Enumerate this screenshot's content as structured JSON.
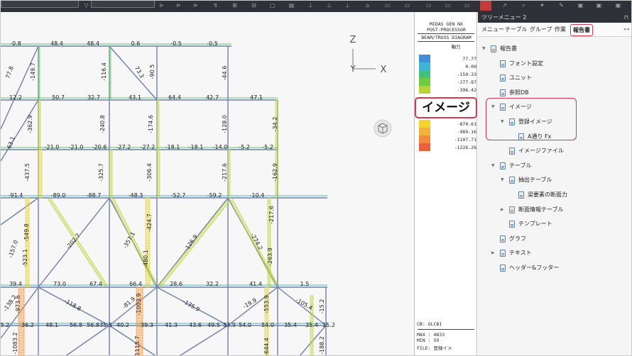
{
  "viewport": {
    "frame_values": {
      "top_beams": [
        "-0.8",
        "48.4",
        "48.4",
        "0.6",
        "-0.5",
        "-0.5"
      ],
      "row1": [
        "12.2",
        "50.7",
        "32.7",
        "43.1",
        "64.4",
        "42.7",
        "47.1"
      ],
      "row2": [
        "-21.0",
        "-21.0",
        "-20.6",
        "-27.2",
        "-27.2",
        "-18.1",
        "-18.1",
        "-14.0",
        "-5.2",
        "-5.2"
      ],
      "row3": [
        "-91.4",
        "-89.0",
        "-88.7",
        "-48.3",
        "-52.7",
        "-59.2",
        "-10.4"
      ],
      "row4": [
        "39.4",
        "73.0",
        "67.4",
        "66.4",
        "28.6",
        "32.2",
        "41.4",
        "1.5"
      ],
      "row5": [
        "5.2",
        "36.2",
        "48.1",
        "56.8",
        "56.8",
        "35.5",
        "40.2",
        "39.3",
        "41.3",
        "43.6",
        "49.5",
        "53.9",
        "54.0",
        "54.0",
        "35.4",
        "35.4",
        "15.2"
      ],
      "columns_top": [
        "77.8",
        "-149.7",
        "-116.4",
        "73.3",
        "-90.5",
        "-44.6"
      ],
      "columns_mid": [
        "-362.9",
        "-240.8",
        "-174.6",
        "-128.0",
        "-34.2",
        "63.1"
      ],
      "columns_low": [
        "-437.5",
        "-325.7",
        "-306.4",
        "-217.6",
        "-162.9"
      ],
      "columns_lower": [
        "-549.8",
        "-157.0",
        "-523.1",
        "-202.7",
        "-357.1",
        "-424.7",
        "-480.1",
        "-126.9",
        "-274.2",
        "-217.6",
        "-263.9"
      ],
      "columns_bottom": [
        "-138.2",
        "-973.6",
        "-118.8",
        "-81.9",
        "-1003.9",
        "-135.9",
        "-19.9",
        "-553.9",
        "-105.4",
        "-15.2",
        "-1083.2",
        "-1115.7",
        "-644.4",
        "-188.2"
      ]
    },
    "axes": {
      "z_label": "Z",
      "y_label": "Y",
      "x_label": "X"
    },
    "view_cube_icon": "cube-icon"
  },
  "legend": {
    "title1": "MIDAS GEN NX",
    "title2": "POST-PROCESSOR",
    "title3": "BEAM/TRUSS DIAGRAM",
    "quantity": "軸力",
    "levels": [
      {
        "value": "77.77",
        "color": "#3c8fd8"
      },
      {
        "value": "0.00",
        "color": "#3fb6d6"
      },
      {
        "value": "-159.33",
        "color": "#44c07b"
      },
      {
        "value": "-277.87",
        "color": "#6fcb3d"
      },
      {
        "value": "-396.42",
        "color": "#b5d535"
      },
      {
        "value": "-870.61",
        "color": "#f5d42a"
      },
      {
        "value": "-989.16",
        "color": "#f3b23a"
      },
      {
        "value": "-1107.71",
        "color": "#f08c3c"
      },
      {
        "value": "-1226.26",
        "color": "#e8613a"
      }
    ],
    "footer": {
      "cb": "CB: GLCB1",
      "max": "MAX : 4833",
      "min": "MIN : 59",
      "file": "FILE: 登録イメ"
    }
  },
  "callout": {
    "text": "イメージ"
  },
  "panel": {
    "title": "ツリーメニュー 2",
    "menu": [
      "メニュー",
      "テーブル",
      "グループ",
      "作業",
      "報告書"
    ],
    "active_menu": "報告書",
    "tree": [
      {
        "label": "報告書",
        "level": 0,
        "expanded": true
      },
      {
        "label": "フォント設定",
        "level": 1
      },
      {
        "label": "ユニット",
        "level": 1
      },
      {
        "label": "参照DB",
        "level": 1
      },
      {
        "label": "イメージ",
        "level": 1,
        "expanded": true
      },
      {
        "label": "登録イメージ",
        "level": 2,
        "expanded": true
      },
      {
        "label": "A通り Fx",
        "level": 3
      },
      {
        "label": "イメージファイル",
        "level": 2
      },
      {
        "label": "テーブル",
        "level": 1,
        "expanded": true
      },
      {
        "label": "抽出テーブル",
        "level": 2,
        "expanded": true
      },
      {
        "label": "梁要素の断面力",
        "level": 3
      },
      {
        "label": "断面情報テーブル",
        "level": 2,
        "expanded": false
      },
      {
        "label": "テンプレート",
        "level": 2
      },
      {
        "label": "グラフ",
        "level": 1
      },
      {
        "label": "テキスト",
        "level": 1,
        "expanded": false
      },
      {
        "label": "ヘッダー&フッター",
        "level": 1
      }
    ]
  }
}
